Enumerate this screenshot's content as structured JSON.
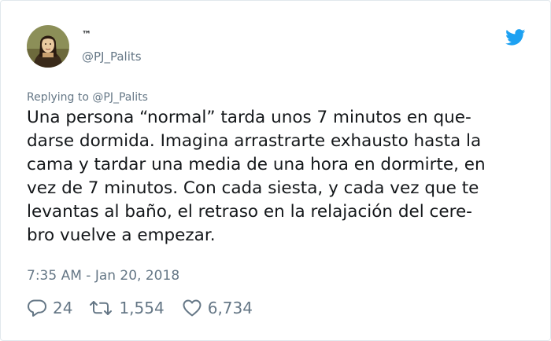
{
  "header": {
    "display_name": "™",
    "handle": "@PJ_Palits",
    "avatar_icon": "avatar-illustration-icon",
    "logo_icon": "twitter-bird-icon"
  },
  "tweet": {
    "replying_prefix": "Replying to",
    "replying_to": "@PJ_Palits",
    "text_lines": [
      "Una persona “normal” tarda unos 7 minutos en que-",
      "darse dormida. Imagina arrastrarte exhausto hasta la",
      "cama y tardar una media de una hora en dormirte, en",
      "vez de 7 minutos. Con cada siesta, y cada vez que te",
      "levantas al baño, el retraso en la relajación del cere-",
      "bro vuelve a empezar."
    ],
    "timestamp": "7:35 AM - Jan 20, 2018"
  },
  "actions": {
    "replies": "24",
    "retweets": "1,554",
    "likes": "6,734"
  },
  "colors": {
    "text": "#14171a",
    "secondary": "#657786",
    "twitter_blue": "#1da1f2",
    "border": "#e1e8ed"
  }
}
